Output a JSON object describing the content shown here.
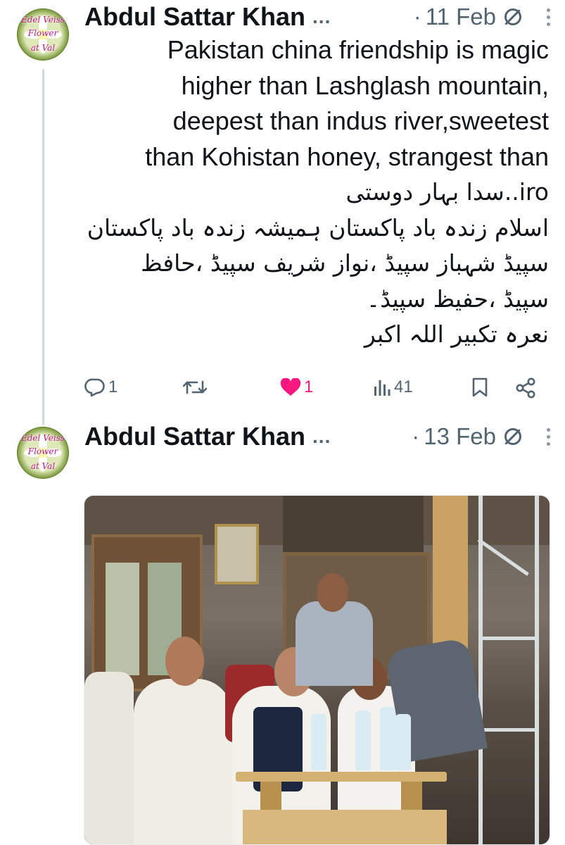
{
  "avatar_text": [
    "Edel Veiss",
    "Flower",
    "at Val"
  ],
  "tweets": [
    {
      "author": "Abdul Sattar Khan",
      "ellipsis": "...",
      "date": "11 Feb",
      "text_lines": [
        "Pakistan china friendship is magic",
        "higher than Lashglash mountain,",
        "deepest than indus river,sweetest",
        "than Kohistan honey, strangest than",
        "iro..سدا بہار دوستی",
        "اسلام زندہ باد پاکستان ہمیشہ زندہ باد پاکستان",
        "سپیڈ شہباز سپیڈ ،نواز شریف سپیڈ ،حافظ",
        "سپیڈ ،حفیظ سپیڈ۔",
        "نعرہ تکبیر اللہ اکبر"
      ],
      "actions": {
        "replies": "1",
        "reposts": "",
        "likes": "1",
        "views": "41"
      }
    },
    {
      "author": "Abdul Sattar Khan",
      "ellipsis": "...",
      "date": "13 Feb"
    }
  ],
  "colors": {
    "text": "#0f1419",
    "muted": "#536471",
    "like": "#f91880",
    "thread_line": "#cfd9de"
  },
  "icons": [
    "reply-icon",
    "repost-icon",
    "like-icon",
    "views-icon",
    "bookmark-icon",
    "share-icon",
    "circle-slash-icon",
    "more-icon"
  ]
}
